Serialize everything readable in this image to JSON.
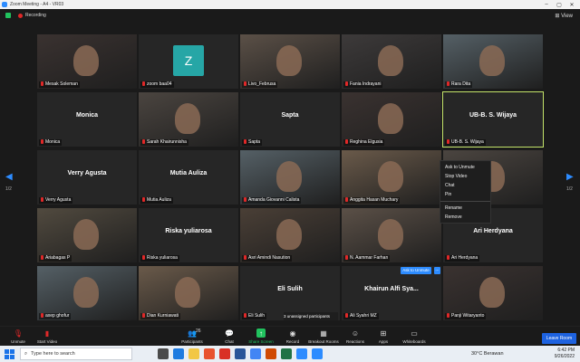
{
  "window": {
    "title": "Zoom Meeting - A4 - VR03"
  },
  "status": {
    "recording_label": "Recording"
  },
  "pages": {
    "left": "1/2",
    "right": "1/2"
  },
  "grid": [
    {
      "label": "Mesak Soleman",
      "name": "",
      "video": true
    },
    {
      "label": "zoom baa04",
      "name": "",
      "avatar_letter": "Z"
    },
    {
      "label": "Livo_Februsa",
      "name": "",
      "video": true
    },
    {
      "label": "Fania Indrayani",
      "name": "",
      "video": true
    },
    {
      "label": "Rara Dita",
      "name": "",
      "video": true
    },
    {
      "label": "Monica",
      "name": "Monica"
    },
    {
      "label": "Sarah Khairunnisha",
      "name": "",
      "video": true
    },
    {
      "label": "Sapta",
      "name": "Sapta"
    },
    {
      "label": "Reghina Elgusia",
      "name": "",
      "video": true
    },
    {
      "label": "UB-B. S. Wijaya",
      "name": "UB-B. S. Wijaya",
      "active": true
    },
    {
      "label": "Verry Agusta",
      "name": "Verry Agusta"
    },
    {
      "label": "Mutia Auliza",
      "name": "Mutia Auliza"
    },
    {
      "label": "Amanda Giovanni Calista",
      "name": "",
      "video": true
    },
    {
      "label": "Anggita Hasan Muchary",
      "name": "",
      "video": true
    },
    {
      "label": "",
      "name": "",
      "video": true
    },
    {
      "label": "Ariabagas P",
      "name": "",
      "video": true
    },
    {
      "label": "Riska yuliarosa",
      "name": "Riska yuliarosa"
    },
    {
      "label": "Asri Amindi Nasution",
      "name": "",
      "video": true
    },
    {
      "label": "N. Aammar Farhan",
      "name": "",
      "video": true
    },
    {
      "label": "Ari Herdyana",
      "name": "Ari Herdyana"
    },
    {
      "label": "axep ghofur",
      "name": "",
      "video": true
    },
    {
      "label": "Dian Kurniawati",
      "name": "",
      "video": true
    },
    {
      "label": "Eli Sulih",
      "name": "Eli Sulih"
    },
    {
      "label": "Ali Syahri MZ",
      "name": "Khairun Alfi Sya..."
    },
    {
      "label": "Panji Witaryanto",
      "name": "",
      "video": true
    }
  ],
  "context_menu": {
    "items": [
      "Ask to Unmute",
      "Stop Video",
      "Chat",
      "Pin"
    ],
    "items2": [
      "Rename",
      "Remove"
    ]
  },
  "tile_actions": {
    "ask_to_unmute": "Ask to Unmute",
    "more": "..."
  },
  "unassigned": "3 unassigned participants",
  "toolbar": {
    "unmute": "Unmute",
    "start_video": "Start Video",
    "participants": "Participants",
    "participants_count": "26",
    "chat": "Chat",
    "share_screen": "Share Screen",
    "record": "Record",
    "breakout": "Breakout Rooms",
    "reactions": "Reactions",
    "apps": "Apps",
    "whiteboards": "Whiteboards",
    "leave": "Leave Room"
  },
  "taskbar": {
    "search_placeholder": "Type here to search",
    "weather": "30°C  Berawan",
    "time": "6:42 PM",
    "date": "9/26/2022"
  },
  "colors": {
    "accent": "#2d8cff",
    "active_border": "#c4e46a",
    "mic_off": "#e02828",
    "leave": "#1d62e0"
  }
}
